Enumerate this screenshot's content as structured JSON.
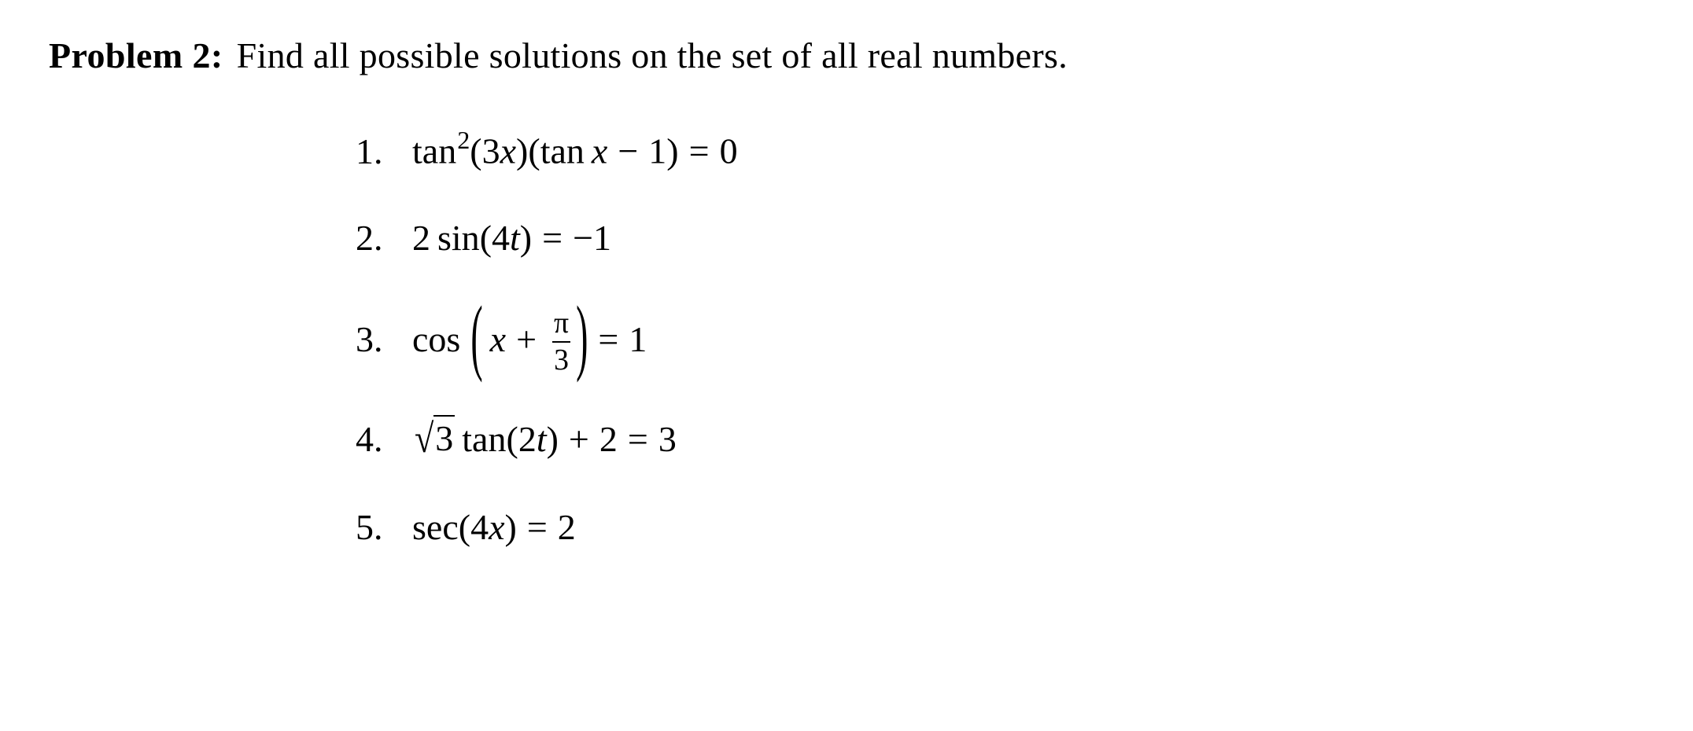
{
  "document": {
    "background_color": "#ffffff",
    "text_color": "#000000"
  },
  "problem": {
    "label": "Problem 2:",
    "statement": "Find all possible solutions on the set of all real numbers."
  },
  "equations": {
    "markers": [
      "1.",
      "2.",
      "3.",
      "4.",
      "5."
    ],
    "items": [
      {
        "marker": "1.",
        "plain_text": "tan^2(3x)(tan x - 1) = 0",
        "parts": {
          "fn1": "tan",
          "exponent": "2",
          "open1": "(",
          "coef1": "3",
          "var1": "x",
          "close1": ")",
          "open2": "(",
          "fn2": "tan",
          "var2": "x",
          "minus": "−",
          "one": "1",
          "close2": ")",
          "equals": "=",
          "rhs": "0"
        }
      },
      {
        "marker": "2.",
        "plain_text": "2 sin(4t) = -1",
        "parts": {
          "coef": "2",
          "fn": "sin",
          "open": "(",
          "inner_coef": "4",
          "var": "t",
          "close": ")",
          "equals": "=",
          "neg": "−",
          "rhs": "1"
        }
      },
      {
        "marker": "3.",
        "plain_text": "cos(x + pi/3) = 1",
        "parts": {
          "fn": "cos",
          "open": "(",
          "var": "x",
          "plus": "+",
          "frac_num": "π",
          "frac_den": "3",
          "close": ")",
          "equals": "=",
          "rhs": "1"
        }
      },
      {
        "marker": "4.",
        "plain_text": "sqrt(3) tan(2t) + 2 = 3",
        "parts": {
          "radical": "√",
          "radicand": "3",
          "fn": "tan",
          "open": "(",
          "inner_coef": "2",
          "var": "t",
          "close": ")",
          "plus": "+",
          "addend": "2",
          "equals": "=",
          "rhs": "3"
        }
      },
      {
        "marker": "5.",
        "plain_text": "sec(4x) = 2",
        "parts": {
          "fn": "sec",
          "open": "(",
          "inner_coef": "4",
          "var": "x",
          "close": ")",
          "equals": "=",
          "rhs": "2"
        }
      }
    ]
  }
}
